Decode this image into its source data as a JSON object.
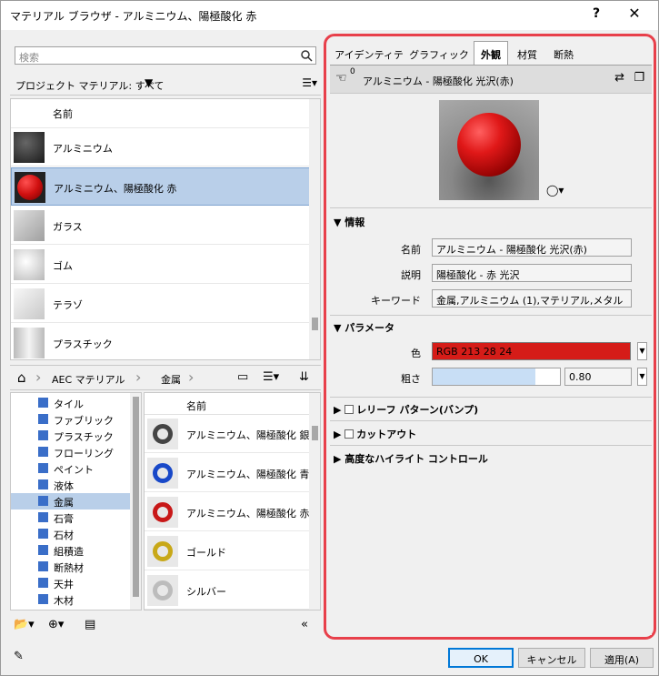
{
  "window": {
    "title": "マテリアル ブラウザ - アルミニウム、陽極酸化 赤",
    "help": "?",
    "close": "✕"
  },
  "search": {
    "placeholder": "検索"
  },
  "project": {
    "label": "プロジェクト マテリアル: すべて",
    "filter_glyph": "▼",
    "view_glyph": "☰▾"
  },
  "project_materials": {
    "header": "名前",
    "items": [
      {
        "name": "アルミニウム",
        "thumb": "#2b2b2b"
      },
      {
        "name": "アルミニウム、陽極酸化 赤",
        "thumb": "#e01818",
        "selected": true
      },
      {
        "name": "ガラス",
        "thumb": "#c8c8c8"
      },
      {
        "name": "ゴム",
        "thumb": "#dcdcdc"
      },
      {
        "name": "テラゾ",
        "thumb": "#f0f0f0"
      },
      {
        "name": "プラスチック",
        "thumb": "#d8d8d8"
      }
    ]
  },
  "library": {
    "breadcrumb": [
      "AEC マテリアル",
      "金属"
    ],
    "categories": [
      "タイル",
      "ファブリック",
      "プラスチック",
      "フローリング",
      "ペイント",
      "液体",
      "金属",
      "石膏",
      "石材",
      "組積造",
      "断熱材",
      "天井",
      "木材"
    ],
    "selected_category": "金属",
    "header": "名前",
    "items": [
      {
        "name": "アルミニウム、陽極酸化 銀",
        "ring": "#444444"
      },
      {
        "name": "アルミニウム、陽極酸化 青",
        "ring": "#1848c8"
      },
      {
        "name": "アルミニウム、陽極酸化 赤",
        "ring": "#c81818"
      },
      {
        "name": "ゴールド",
        "ring": "#c8a818"
      },
      {
        "name": "シルバー",
        "ring": "#bcbcbc"
      }
    ]
  },
  "tabs": [
    "アイデンティティ",
    "グラフィックス",
    "外観",
    "材質",
    "断熱"
  ],
  "active_tab": "外観",
  "asset": {
    "name": "アルミニウム - 陽極酸化 光沢(赤)",
    "count": "0"
  },
  "info": {
    "title": "情報",
    "name_label": "名前",
    "name_value": "アルミニウム - 陽極酸化 光沢(赤)",
    "desc_label": "説明",
    "desc_value": "陽極酸化 - 赤 光沢",
    "kw_label": "キーワード",
    "kw_value": "金属,アルミニウム (1),マテリアル,メタル"
  },
  "params": {
    "title": "パラメータ",
    "color_label": "色",
    "color_value": "RGB 213 28 24",
    "color_hex": "#d51c18",
    "rough_label": "粗さ",
    "rough_value": "0.80"
  },
  "sections": {
    "relief": "レリーフ パターン(バンプ)",
    "cutout": "カットアウト",
    "highlight": "高度なハイライト コントロール"
  },
  "buttons": {
    "ok": "OK",
    "cancel": "キャンセル",
    "apply": "適用(A)"
  }
}
